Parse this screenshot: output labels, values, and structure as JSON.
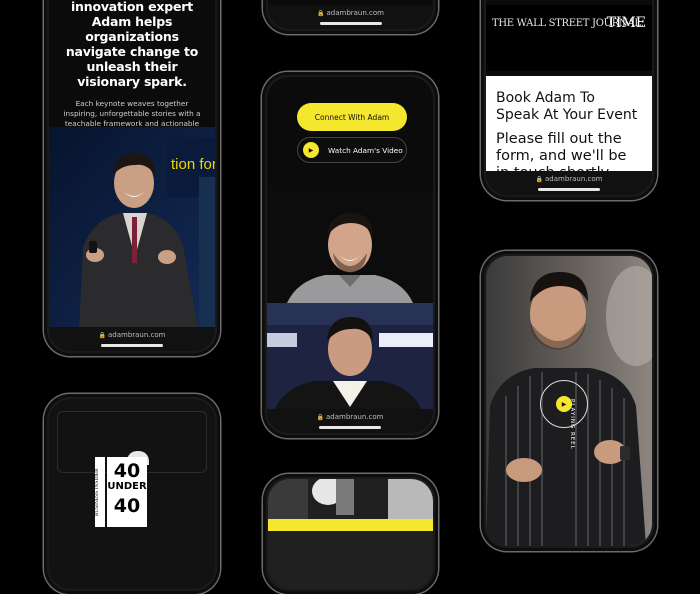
{
  "phone1": {
    "headline": "innovation expert Adam helps organizations navigate change to unleash their visionary spark.",
    "body": "Each keynote weaves together inspiring, unforgettable stories with a teachable framework and actionable takeaways learned from working with leaders at the top of their field.",
    "url": "adambraun.com",
    "stage_text": "tion for bu"
  },
  "phone2": {
    "url": "adambraun.com"
  },
  "phone3": {
    "cta_label": "Connect With Adam",
    "video_label": "Watch Adam's Video",
    "url": "adambraun.com"
  },
  "phone4": {
    "logo_wsj": "THE WALL STREET JOURNAL.",
    "logo_time": "TIME",
    "heading": "Book Adam To Speak At Your Event",
    "body": "Please fill out the form, and we'll be in touch shortly.",
    "url": "adambraun.com"
  },
  "phone6": {
    "badge_text": "PLAYING REEL"
  },
  "phone7": {
    "award_number": "40",
    "award_under": "UNDER",
    "award_number2": "40",
    "publication": "BUSINESS INSIDER"
  },
  "colors": {
    "accent": "#f5e62e",
    "background": "#000000"
  }
}
